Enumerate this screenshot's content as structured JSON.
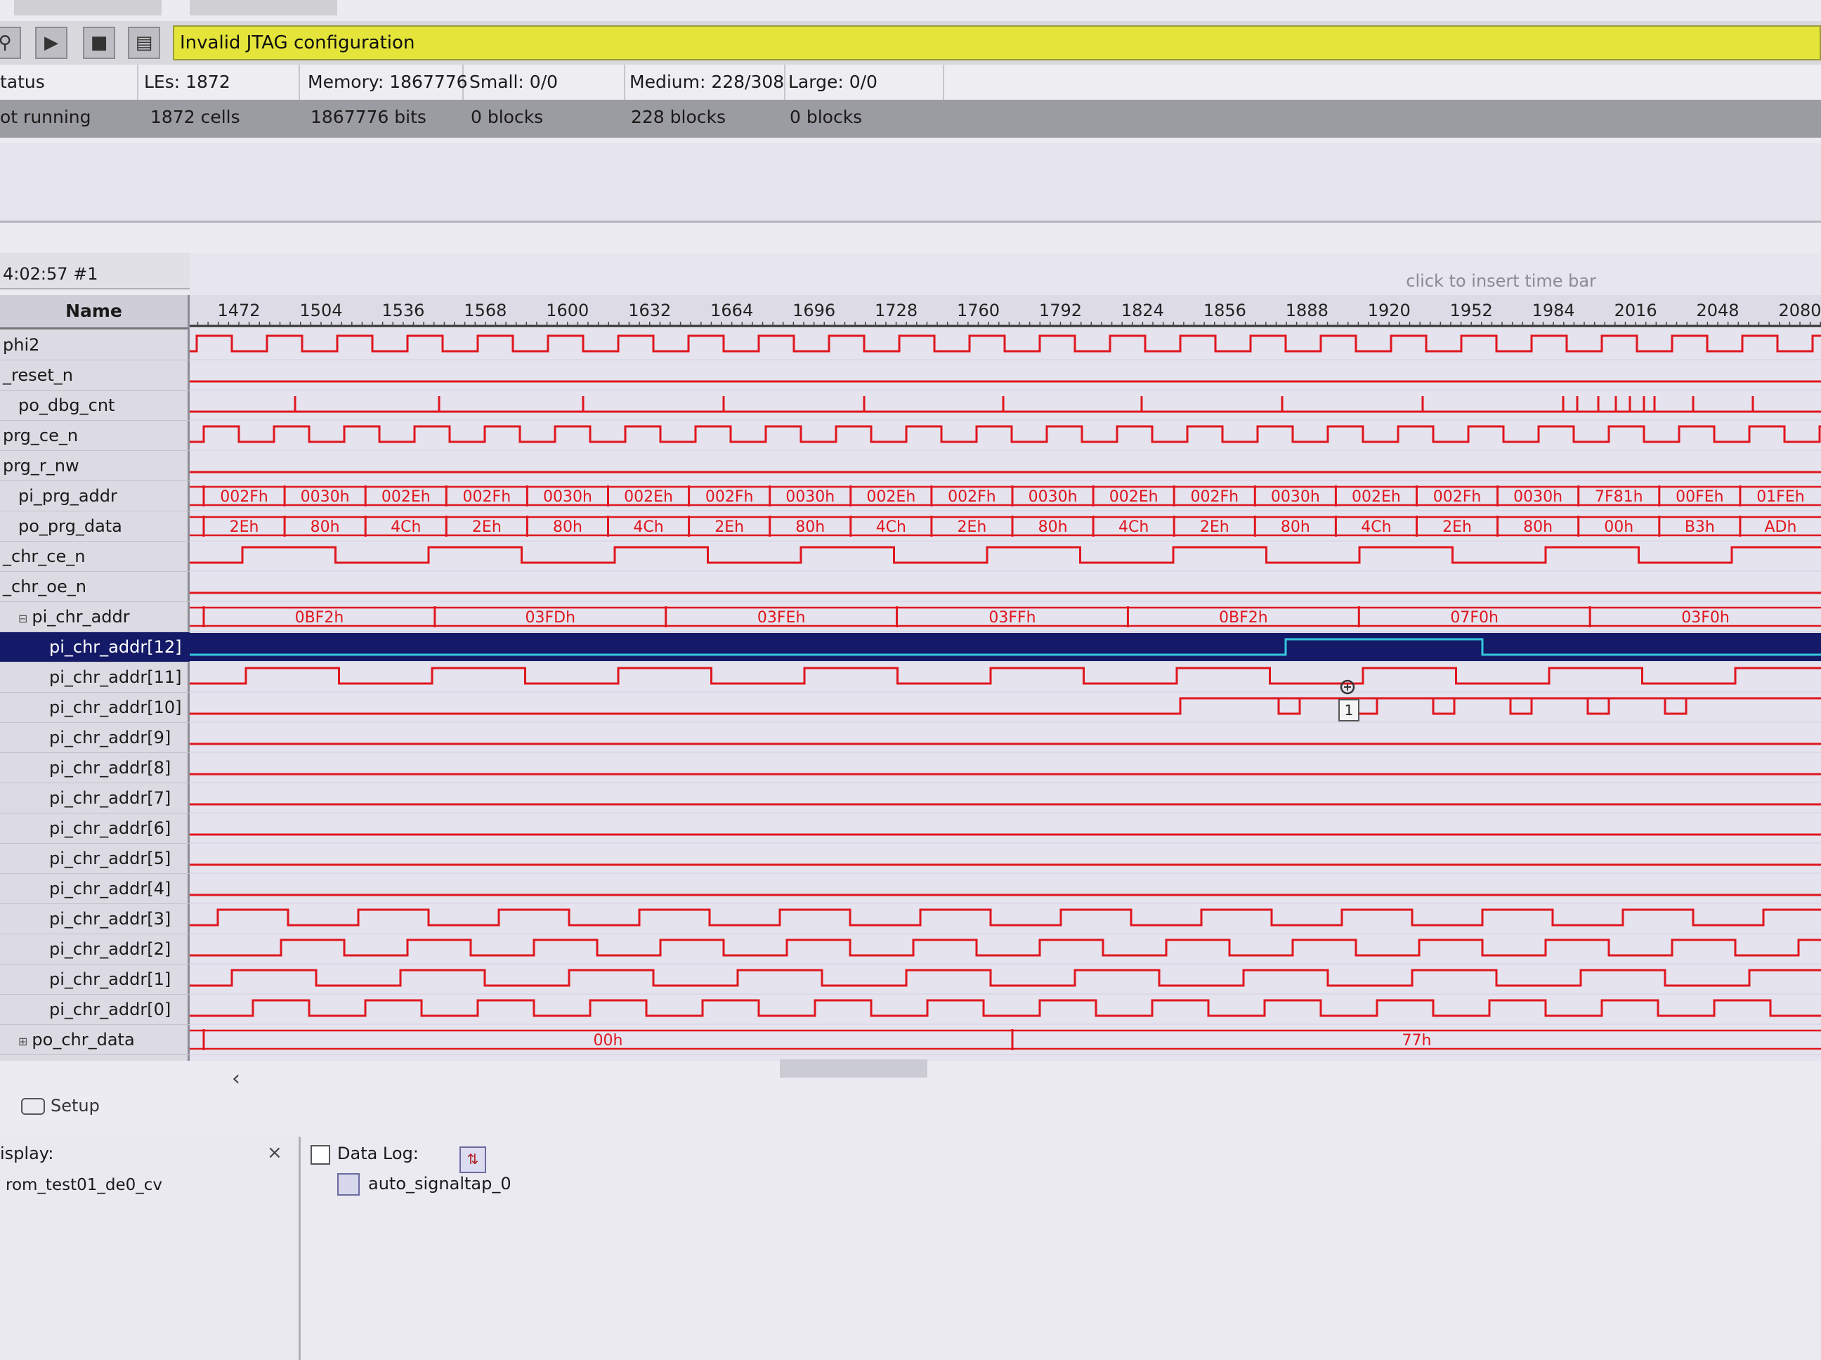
{
  "toolbar": {
    "buttons": [
      {
        "icon": "magnifier-icon",
        "glyph": "⚲"
      },
      {
        "icon": "run-icon",
        "glyph": "▶"
      },
      {
        "icon": "stop-icon",
        "glyph": "■"
      },
      {
        "icon": "read-data-icon",
        "glyph": "▤"
      }
    ],
    "message": "Invalid JTAG configuration"
  },
  "resources": {
    "header": [
      "tatus",
      "LEs: 1872",
      "Memory: 1867776",
      "Small: 0/0",
      "Medium: 228/308",
      "Large: 0/0"
    ],
    "values": [
      "ot running",
      "1872 cells",
      "1867776 bits",
      "0 blocks",
      "228 blocks",
      "0 blocks"
    ]
  },
  "timebar": {
    "timestamp": "4:02:57  #1",
    "insert_hint": "click to insert time bar",
    "ticks": [
      "1472",
      "1504",
      "1536",
      "1568",
      "1600",
      "1632",
      "1664",
      "1696",
      "1728",
      "1760",
      "1792",
      "1824",
      "1856",
      "1888",
      "1920",
      "1952",
      "1984",
      "2016",
      "2048",
      "2080"
    ]
  },
  "signals": {
    "header": "Name",
    "rows": [
      {
        "label": "phi2",
        "indent": 0,
        "type": "clock",
        "period": 100,
        "start": 10
      },
      {
        "label": "_reset_n",
        "indent": 0,
        "type": "flat"
      },
      {
        "label": "po_dbg_cnt",
        "indent": 1,
        "type": "ticks",
        "marks": [
          150,
          355,
          560,
          760,
          960,
          1158,
          1355,
          1555,
          1755,
          1955,
          1975,
          2005,
          2030,
          2050,
          2070,
          2085,
          2140,
          2225,
          2420
        ]
      },
      {
        "label": "prg_ce_n",
        "indent": 0,
        "type": "clock",
        "period": 100,
        "start": 20
      },
      {
        "label": "prg_r_nw",
        "indent": 0,
        "type": "flat"
      },
      {
        "label": "pi_prg_addr",
        "indent": 1,
        "expander": "",
        "type": "bus"
      },
      {
        "label": "po_prg_data",
        "indent": 1,
        "expander": "",
        "type": "bus"
      },
      {
        "label": "_chr_ce_n",
        "indent": 0,
        "type": "clock",
        "period": 265,
        "start": 75
      },
      {
        "label": "_chr_oe_n",
        "indent": 0,
        "type": "flat"
      },
      {
        "label": "pi_chr_addr",
        "indent": 1,
        "expander": "⊟",
        "type": "bus"
      },
      {
        "label": "pi_chr_addr[12]",
        "indent": 3,
        "type": "selected"
      },
      {
        "label": "pi_chr_addr[11]",
        "indent": 3,
        "type": "clock",
        "period": 265,
        "start": 80
      },
      {
        "label": "pi_chr_addr[10]",
        "indent": 3,
        "type": "step",
        "at": 1410
      },
      {
        "label": "pi_chr_addr[9]",
        "indent": 3,
        "type": "flat"
      },
      {
        "label": "pi_chr_addr[8]",
        "indent": 3,
        "type": "flat"
      },
      {
        "label": "pi_chr_addr[7]",
        "indent": 3,
        "type": "flat"
      },
      {
        "label": "pi_chr_addr[6]",
        "indent": 3,
        "type": "flat"
      },
      {
        "label": "pi_chr_addr[5]",
        "indent": 3,
        "type": "flat"
      },
      {
        "label": "pi_chr_addr[4]",
        "indent": 3,
        "type": "flat"
      },
      {
        "label": "pi_chr_addr[3]",
        "indent": 3,
        "type": "clock",
        "period": 200,
        "start": 40
      },
      {
        "label": "pi_chr_addr[2]",
        "indent": 3,
        "type": "clock",
        "period": 180,
        "start": 130
      },
      {
        "label": "pi_chr_addr[1]",
        "indent": 3,
        "type": "clock",
        "period": 240,
        "start": 60
      },
      {
        "label": "pi_chr_addr[0]",
        "indent": 3,
        "type": "clock",
        "period": 160,
        "start": 90
      },
      {
        "label": "po_chr_data",
        "indent": 1,
        "expander": "⊞",
        "type": "bus"
      }
    ]
  },
  "buses": {
    "pi_prg_addr": [
      "002Fh",
      "0030h",
      "002Eh",
      "002Fh",
      "0030h",
      "002Eh",
      "002Fh",
      "0030h",
      "002Eh",
      "002Fh",
      "0030h",
      "002Eh",
      "002Fh",
      "0030h",
      "002Eh",
      "002Fh",
      "0030h",
      "7F81h",
      "00FEh",
      "01FEh"
    ],
    "po_prg_data": [
      "2Eh",
      "80h",
      "4Ch",
      "2Eh",
      "80h",
      "4Ch",
      "2Eh",
      "80h",
      "4Ch",
      "2Eh",
      "80h",
      "4Ch",
      "2Eh",
      "80h",
      "4Ch",
      "2Eh",
      "80h",
      "00h",
      "B3h",
      "ADh"
    ],
    "pi_chr_addr": [
      "0BF2h",
      "03FDh",
      "03FEh",
      "03FFh",
      "0BF2h",
      "07F0h",
      "03F0h"
    ],
    "po_chr_data": [
      "00h",
      "77h"
    ]
  },
  "cursor": {
    "tooltip": "1"
  },
  "bottom": {
    "setup_tab": "Setup",
    "display_label": "isplay:",
    "display_item": "rom_test01_de0_cv",
    "close_glyph": "×",
    "datalog_label": "Data Log:",
    "instance": "auto_signaltap_0",
    "scroll_glyph": "‹"
  },
  "colors": {
    "wave": "#e0161e",
    "selected_bg": "#141a68",
    "selected_wave": "#35c8dc",
    "message_bg": "#e4e43a"
  }
}
